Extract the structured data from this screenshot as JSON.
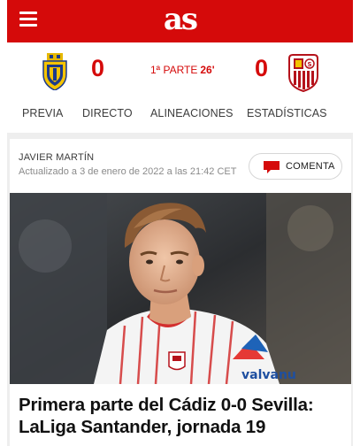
{
  "header": {
    "logo": "as",
    "menu_icon": "hamburger-menu-icon"
  },
  "match": {
    "home": {
      "crest_icon": "cadiz-crest-icon",
      "score": "0"
    },
    "away": {
      "crest_icon": "sevilla-crest-icon",
      "score": "0"
    },
    "period": "1ª PARTE",
    "minute": "26'"
  },
  "tabs": [
    {
      "label": "PREVIA"
    },
    {
      "label": "DIRECTO"
    },
    {
      "label": "ALINEACIONES"
    },
    {
      "label": "ESTADÍSTICAS"
    }
  ],
  "article": {
    "author": "JAVIER MARTÍN",
    "updated": "Actualizado a 3 de enero de 2022 a las 21:42 CET",
    "comment_button": {
      "label": "COMENTA",
      "icon": "comment-bubble-icon"
    },
    "photo_text": "valvanu",
    "headline_line1": "Primera parte del Cádiz 0-0 Sevilla:",
    "headline_line2": "LaLiga Santander, jornada 19"
  },
  "colors": {
    "brand_red": "#d50a0a",
    "background_grey": "#eeeeee"
  }
}
